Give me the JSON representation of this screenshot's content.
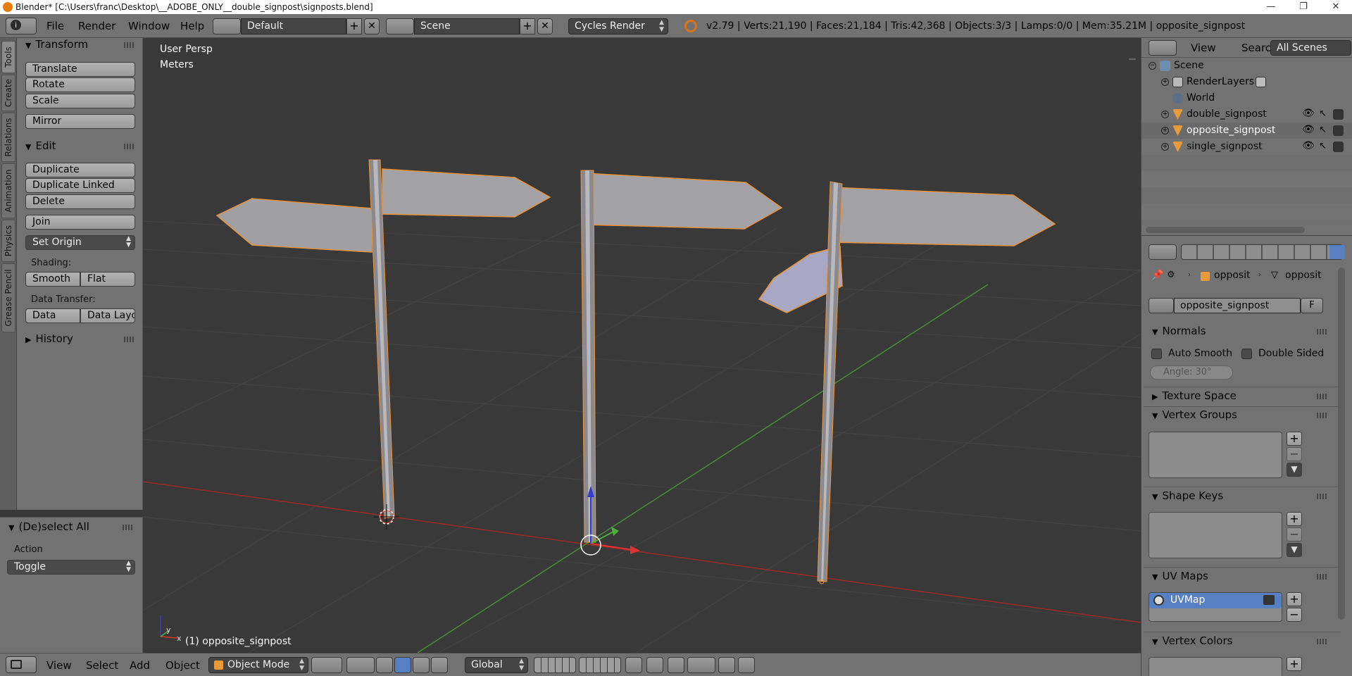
{
  "window": {
    "title": "Blender* [C:\\Users\\franc\\Desktop\\__ADOBE_ONLY__double_signpost\\signposts.blend]",
    "controls": [
      "—",
      "❐",
      "✕"
    ]
  },
  "info_header": {
    "menus": [
      "File",
      "Render",
      "Window",
      "Help"
    ],
    "screen_layout": "Default",
    "scene": "Scene",
    "render_engine": "Cycles Render",
    "stats": "v2.79 | Verts:21,190 | Faces:21,184 | Tris:42,368 | Objects:3/3 | Lamps:0/0 | Mem:35.21M | opposite_signpost"
  },
  "tool_tabs": [
    "Tools",
    "Create",
    "Relations",
    "Animation",
    "Physics",
    "Grease Pencil"
  ],
  "tool_shelf": {
    "transform_title": "Transform",
    "transform_buttons": [
      "Translate",
      "Rotate",
      "Scale"
    ],
    "mirror": "Mirror",
    "edit_title": "Edit",
    "edit_buttons": [
      "Duplicate",
      "Duplicate Linked",
      "Delete"
    ],
    "join": "Join",
    "set_origin": "Set Origin",
    "shading_label": "Shading:",
    "shading_smooth": "Smooth",
    "shading_flat": "Flat",
    "data_transfer_label": "Data Transfer:",
    "data": "Data",
    "data_layout": "Data Layo",
    "history_title": "History"
  },
  "operator_panel": {
    "title": "(De)select All",
    "action_label": "Action",
    "action_value": "Toggle"
  },
  "viewport": {
    "view_name": "User Persp",
    "units": "Meters",
    "active_object": "(1) opposite_signpost",
    "axis_x": "x",
    "axis_y": "y"
  },
  "bottom_header": {
    "menus": [
      "View",
      "Select",
      "Add",
      "Object"
    ],
    "mode": "Object Mode",
    "orientation": "Global"
  },
  "outliner": {
    "header_buttons": [
      "View",
      "Search",
      "All Scenes"
    ],
    "items": [
      {
        "name": "Scene",
        "icon": "scene-icon"
      },
      {
        "name": "RenderLayers",
        "icon": "render-layers-icon"
      },
      {
        "name": "World",
        "icon": "world-icon"
      },
      {
        "name": "double_signpost",
        "icon": "mesh-object-icon"
      },
      {
        "name": "opposite_signpost",
        "icon": "mesh-object-icon"
      },
      {
        "name": "single_signpost",
        "icon": "mesh-object-icon"
      }
    ]
  },
  "properties": {
    "breadcrumb": [
      "opposit",
      "opposit"
    ],
    "mesh_name": "opposite_signpost",
    "fake_user": "F",
    "normals_title": "Normals",
    "auto_smooth": "Auto Smooth",
    "double_sided": "Double Sided",
    "angle": "Angle:   30°",
    "texture_space": "Texture Space",
    "vertex_groups": "Vertex Groups",
    "shape_keys": "Shape Keys",
    "uv_maps": "UV Maps",
    "uv_map_name": "UVMap",
    "vertex_colors": "Vertex Colors"
  },
  "colors": {
    "selection_outline": "#e8923a",
    "active_highlight": "#5680c2",
    "grid_x_axis": "#9b2b2b",
    "grid_y_axis": "#4a8a3a"
  }
}
